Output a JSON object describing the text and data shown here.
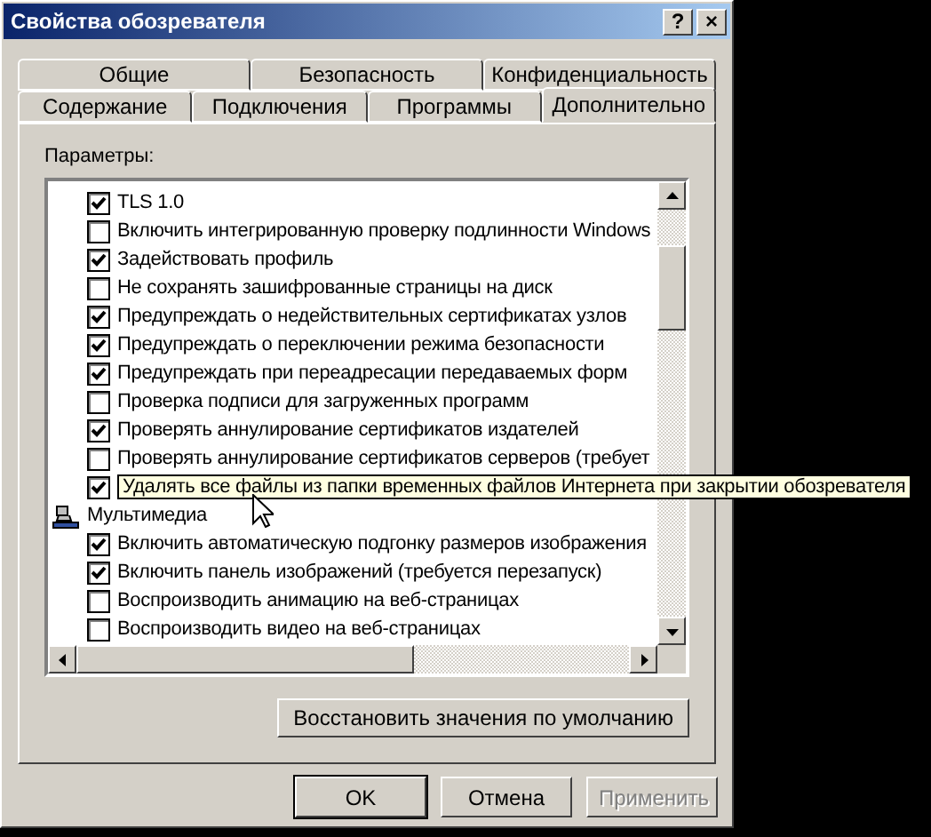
{
  "window": {
    "title": "Свойства обозревателя"
  },
  "title_buttons": [
    "?",
    "×"
  ],
  "tab_rows": [
    [
      {
        "label": "Общие",
        "selected": false
      },
      {
        "label": "Безопасность",
        "selected": false
      },
      {
        "label": "Конфиденциальность",
        "selected": false
      }
    ],
    [
      {
        "label": "Содержание",
        "selected": false
      },
      {
        "label": "Подключения",
        "selected": false
      },
      {
        "label": "Программы",
        "selected": false
      },
      {
        "label": "Дополнительно",
        "selected": true
      }
    ]
  ],
  "settings_label": "Параметры:",
  "settings": [
    {
      "kind": "check",
      "label": "TLS 1.0",
      "checked": true,
      "tooltip": false
    },
    {
      "kind": "check",
      "label": "Включить интегрированную проверку подлинности Windows",
      "checked": false,
      "tooltip": false
    },
    {
      "kind": "check",
      "label": "Задействовать профиль",
      "checked": true,
      "tooltip": false
    },
    {
      "kind": "check",
      "label": "Не сохранять зашифрованные страницы на диск",
      "checked": false,
      "tooltip": false
    },
    {
      "kind": "check",
      "label": "Предупреждать о недействительных сертификатах узлов",
      "checked": true,
      "tooltip": false
    },
    {
      "kind": "check",
      "label": "Предупреждать о переключении режима безопасности",
      "checked": true,
      "tooltip": false
    },
    {
      "kind": "check",
      "label": "Предупреждать при переадресации передаваемых форм",
      "checked": true,
      "tooltip": false
    },
    {
      "kind": "check",
      "label": "Проверка подписи для загруженных программ",
      "checked": false,
      "tooltip": false
    },
    {
      "kind": "check",
      "label": "Проверять аннулирование сертификатов издателей",
      "checked": true,
      "tooltip": false
    },
    {
      "kind": "check",
      "label": "Проверять аннулирование сертификатов серверов (требует",
      "checked": false,
      "tooltip": false
    },
    {
      "kind": "check",
      "label": "Удалять все файлы из папки временных файлов Интернета при закрытии обозревателя",
      "checked": true,
      "tooltip": true
    },
    {
      "kind": "group",
      "label": "Мультимедиа"
    },
    {
      "kind": "check",
      "label": "Включить автоматическую подгонку размеров изображения",
      "checked": true,
      "tooltip": false
    },
    {
      "kind": "check",
      "label": "Включить панель изображений (требуется перезапуск)",
      "checked": true,
      "tooltip": false
    },
    {
      "kind": "check",
      "label": "Воспроизводить анимацию на веб-страницах",
      "checked": false,
      "tooltip": false
    },
    {
      "kind": "check",
      "label": "Воспроизводить видео на веб-страницах",
      "checked": false,
      "tooltip": false
    }
  ],
  "restore_button": "Восстановить значения по умолчанию",
  "buttons": [
    {
      "label": "OK",
      "disabled": false,
      "default": true
    },
    {
      "label": "Отмена",
      "disabled": false,
      "default": false
    },
    {
      "label": "Применить",
      "disabled": true,
      "default": false
    }
  ]
}
